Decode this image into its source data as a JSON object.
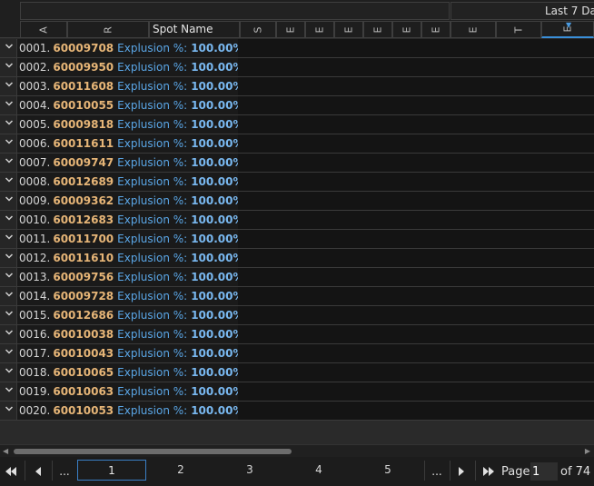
{
  "header": {
    "band_title": "Last 7 Da",
    "columns": [
      {
        "key": "a",
        "label": "A",
        "rotated": true
      },
      {
        "key": "r",
        "label": "R",
        "rotated": true
      },
      {
        "key": "spot",
        "label": "Spot Name",
        "rotated": false
      },
      {
        "key": "s",
        "label": "S",
        "rotated": true
      },
      {
        "key": "e1",
        "label": "E",
        "rotated": true
      },
      {
        "key": "e2",
        "label": "E",
        "rotated": true
      },
      {
        "key": "e3",
        "label": "E",
        "rotated": true
      },
      {
        "key": "e4",
        "label": "E",
        "rotated": true
      },
      {
        "key": "e5",
        "label": "E",
        "rotated": true
      },
      {
        "key": "e6",
        "label": "E",
        "rotated": true
      },
      {
        "key": "e7",
        "label": "E",
        "rotated": true
      },
      {
        "key": "t",
        "label": "T",
        "rotated": true
      },
      {
        "key": "e8",
        "label": "E",
        "rotated": true,
        "sorted": true
      }
    ]
  },
  "groups": [
    {
      "index": "0001.",
      "id": "60009708",
      "label": "Explusion %:",
      "value": "100.00%"
    },
    {
      "index": "0002.",
      "id": "60009950",
      "label": "Explusion %:",
      "value": "100.00%"
    },
    {
      "index": "0003.",
      "id": "60011608",
      "label": "Explusion %:",
      "value": "100.00%"
    },
    {
      "index": "0004.",
      "id": "60010055",
      "label": "Explusion %:",
      "value": "100.00%"
    },
    {
      "index": "0005.",
      "id": "60009818",
      "label": "Explusion %:",
      "value": "100.00%"
    },
    {
      "index": "0006.",
      "id": "60011611",
      "label": "Explusion %:",
      "value": "100.00%"
    },
    {
      "index": "0007.",
      "id": "60009747",
      "label": "Explusion %:",
      "value": "100.00%"
    },
    {
      "index": "0008.",
      "id": "60012689",
      "label": "Explusion %:",
      "value": "100.00%"
    },
    {
      "index": "0009.",
      "id": "60009362",
      "label": "Explusion %:",
      "value": "100.00%"
    },
    {
      "index": "0010.",
      "id": "60012683",
      "label": "Explusion %:",
      "value": "100.00%"
    },
    {
      "index": "0011.",
      "id": "60011700",
      "label": "Explusion %:",
      "value": "100.00%"
    },
    {
      "index": "0012.",
      "id": "60011610",
      "label": "Explusion %:",
      "value": "100.00%"
    },
    {
      "index": "0013.",
      "id": "60009756",
      "label": "Explusion %:",
      "value": "100.00%"
    },
    {
      "index": "0014.",
      "id": "60009728",
      "label": "Explusion %:",
      "value": "100.00%"
    },
    {
      "index": "0015.",
      "id": "60012686",
      "label": "Explusion %:",
      "value": "100.00%"
    },
    {
      "index": "0016.",
      "id": "60010038",
      "label": "Explusion %:",
      "value": "100.00%"
    },
    {
      "index": "0017.",
      "id": "60010043",
      "label": "Explusion %:",
      "value": "100.00%"
    },
    {
      "index": "0018.",
      "id": "60010065",
      "label": "Explusion %:",
      "value": "100.00%"
    },
    {
      "index": "0019.",
      "id": "60010063",
      "label": "Explusion %:",
      "value": "100.00%"
    },
    {
      "index": "0020.",
      "id": "60010053",
      "label": "Explusion %:",
      "value": "100.00%"
    }
  ],
  "pager": {
    "first_icon": "first-page-icon",
    "prev_icon": "previous-page-icon",
    "ellipsis_left": "...",
    "pages": [
      "1",
      "2",
      "3",
      "4",
      "5"
    ],
    "active_page": "1",
    "ellipsis_right": "...",
    "next_icon": "next-page-icon",
    "last_icon": "last-page-icon",
    "page_label": "Page",
    "page_input_value": "1",
    "of_label": "of 74"
  },
  "colors": {
    "accent": "#3a7fc6",
    "id_text": "#e6b577",
    "label_text": "#5aa6e6"
  }
}
